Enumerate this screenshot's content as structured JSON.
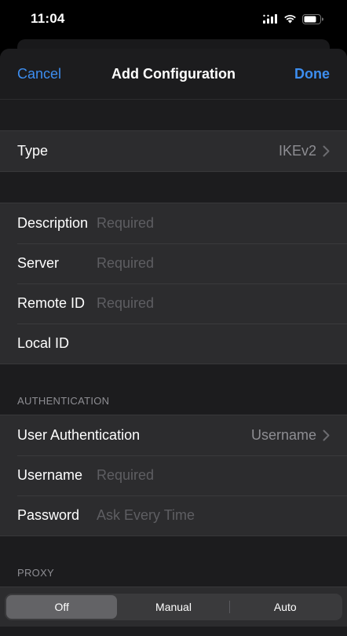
{
  "status_bar": {
    "time": "11:04"
  },
  "nav": {
    "cancel_label": "Cancel",
    "title": "Add Configuration",
    "done_label": "Done"
  },
  "type_row": {
    "label": "Type",
    "value": "IKEv2"
  },
  "fields": {
    "description": {
      "label": "Description",
      "placeholder": "Required",
      "value": ""
    },
    "server": {
      "label": "Server",
      "placeholder": "Required",
      "value": ""
    },
    "remote_id": {
      "label": "Remote ID",
      "placeholder": "Required",
      "value": ""
    },
    "local_id": {
      "label": "Local ID",
      "placeholder": "",
      "value": ""
    }
  },
  "authentication": {
    "header": "AUTHENTICATION",
    "user_auth": {
      "label": "User Authentication",
      "value": "Username"
    },
    "username": {
      "label": "Username",
      "placeholder": "Required",
      "value": ""
    },
    "password": {
      "label": "Password",
      "placeholder": "Ask Every Time",
      "value": ""
    }
  },
  "proxy": {
    "header": "PROXY",
    "options": [
      "Off",
      "Manual",
      "Auto"
    ],
    "selected": "Off"
  },
  "colors": {
    "accent": "#3d8ef0",
    "background": "#000000",
    "sheet": "#1c1c1e",
    "cell": "#2c2c2e"
  },
  "icons": {
    "signal": "cellular-signal-icon",
    "wifi": "wifi-icon",
    "battery": "battery-icon",
    "chevron": "chevron-right-icon"
  }
}
